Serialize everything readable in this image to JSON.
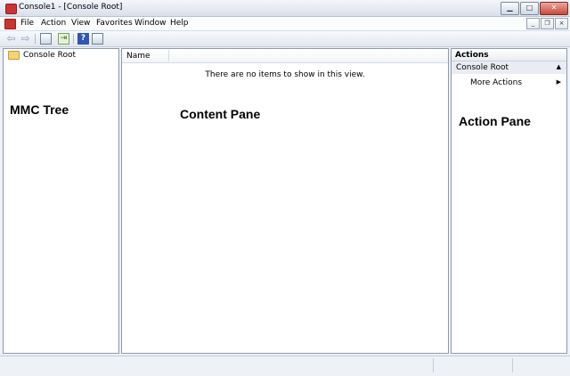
{
  "window": {
    "title": "Console1 - [Console Root]"
  },
  "caption_buttons": {
    "minimize": "▁",
    "maximize": "□",
    "close": "✕"
  },
  "menubar": {
    "items": [
      "File",
      "Action",
      "View",
      "Favorites",
      "Window",
      "Help"
    ]
  },
  "mdi_buttons": {
    "minimize": "_",
    "restore": "❐",
    "close": "×"
  },
  "toolbar": {
    "icons": [
      "back-arrow-icon",
      "forward-arrow-icon",
      "show-hide-tree-icon",
      "export-list-icon",
      "help-icon",
      "show-hide-action-pane-icon"
    ],
    "back_glyph": "⇦",
    "forward_glyph": "⇨",
    "help_glyph": "?",
    "export_glyph": "⇥"
  },
  "tree": {
    "root_label": "Console Root"
  },
  "content": {
    "column_header": "Name",
    "empty_message": "There are no items to show in this view."
  },
  "actions_pane": {
    "header": "Actions",
    "section_title": "Console Root",
    "section_caret": "▲",
    "more_actions": "More Actions",
    "more_caret": "▶"
  },
  "labels": {
    "tree": "MMC Tree",
    "content": "Content Pane",
    "action": "Action Pane"
  }
}
